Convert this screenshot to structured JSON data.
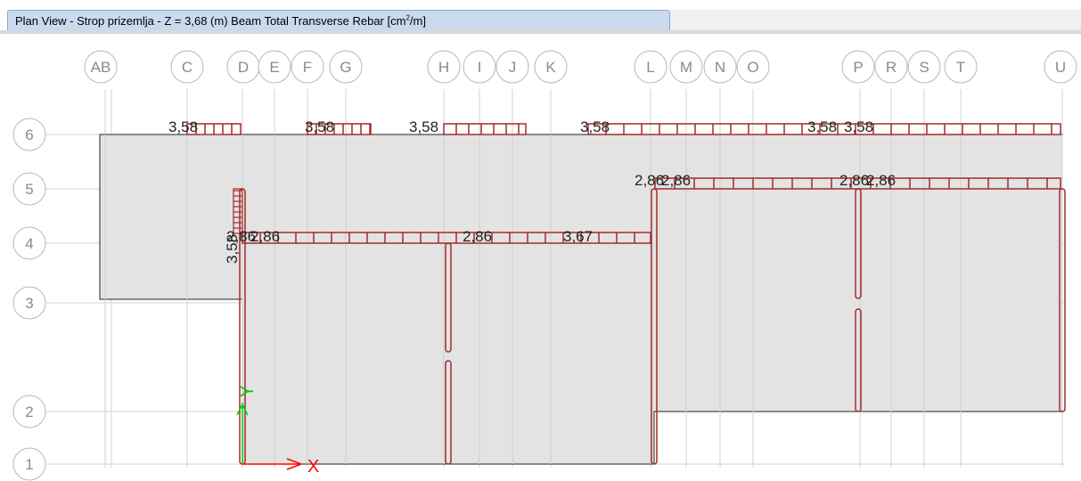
{
  "window": {
    "tab_title_prefix": "Plan View - Strop prizemlja - Z = 3,68 (m)  Beam Total Transverse Rebar  [cm",
    "tab_title_sup": "2",
    "tab_title_suffix": "/m]"
  },
  "grid": {
    "x_labels": [
      "AB",
      "C",
      "D",
      "E",
      "F",
      "G",
      "H",
      "I",
      "J",
      "K",
      "L",
      "M",
      "N",
      "O",
      "P",
      "R",
      "S",
      "T",
      "U"
    ],
    "y_labels": [
      "6",
      "5",
      "4",
      "3",
      "2",
      "1"
    ]
  },
  "beam_values": {
    "row6": [
      "3,58",
      "3,58",
      "3,58",
      "3,58",
      "3,58",
      "3,58"
    ],
    "row5": [
      "2,86",
      "2,86",
      "2,86",
      "2,86"
    ],
    "row4": [
      "2,86",
      "2,86",
      "2,86",
      "3,67"
    ],
    "vertical": [
      "3,58"
    ]
  },
  "axes": {
    "x_label": "X",
    "y_label": "Y"
  },
  "colors": {
    "rebar": "#a52a2a",
    "slab_fill": "#e3e3e3",
    "grid_line": "#d3d3d3",
    "bubble": "#b8b8b8",
    "axis": "#ff0000",
    "axis_y": "#00cc00"
  }
}
